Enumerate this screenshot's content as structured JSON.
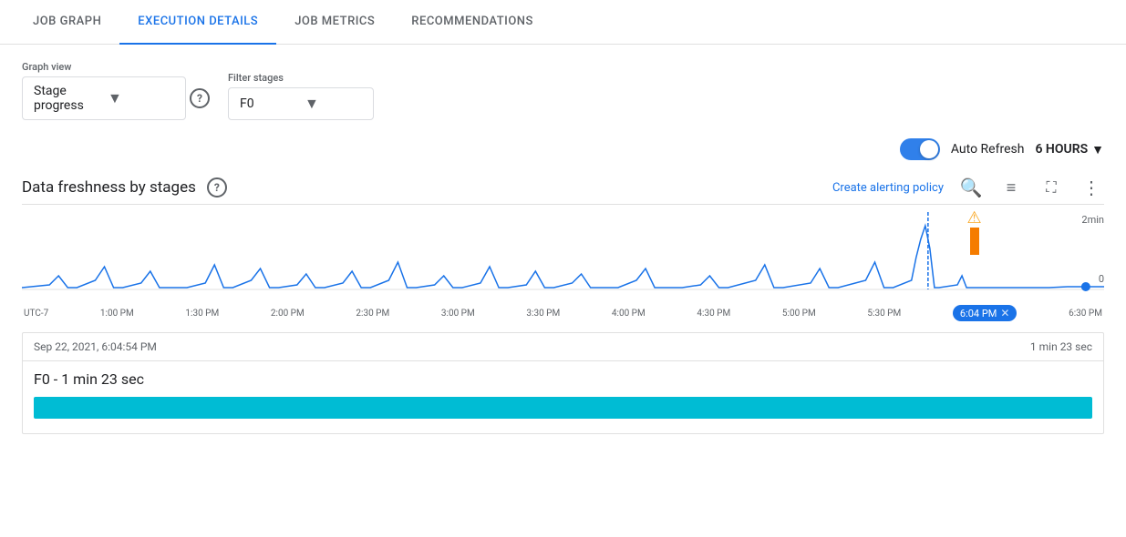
{
  "tabs": [
    {
      "id": "job-graph",
      "label": "JOB GRAPH",
      "active": false
    },
    {
      "id": "execution-details",
      "label": "EXECUTION DETAILS",
      "active": true
    },
    {
      "id": "job-metrics",
      "label": "JOB METRICS",
      "active": false
    },
    {
      "id": "recommendations",
      "label": "RECOMMENDATIONS",
      "active": false
    }
  ],
  "controls": {
    "graph_view": {
      "label": "Graph view",
      "value": "Stage progress",
      "help_label": "?"
    },
    "filter_stages": {
      "label": "Filter stages",
      "value": "F0"
    }
  },
  "auto_refresh": {
    "label": "Auto Refresh",
    "enabled": true,
    "hours_label": "6 HOURS"
  },
  "chart": {
    "title": "Data freshness by stages",
    "help_label": "?",
    "create_alerting_label": "Create alerting policy",
    "y_label_top": "2min",
    "y_label_bottom": "0",
    "x_labels": [
      "UTC-7",
      "1:00 PM",
      "1:30 PM",
      "2:00 PM",
      "2:30 PM",
      "3:00 PM",
      "3:30 PM",
      "4:00 PM",
      "4:30 PM",
      "5:00 PM",
      "5:30 PM",
      "6:04 PM",
      "6:30 PM"
    ]
  },
  "detail": {
    "timestamp": "Sep 22, 2021, 6:04:54 PM",
    "duration": "1 min 23 sec",
    "stage_label": "F0 - 1 min 23 sec"
  },
  "icons": {
    "search": "⌕",
    "layers": "≡",
    "fullscreen": "⛶",
    "more_vert": "⋮",
    "chevron_down": "▼",
    "help": "?",
    "warning": "⚠",
    "close": "✕"
  }
}
